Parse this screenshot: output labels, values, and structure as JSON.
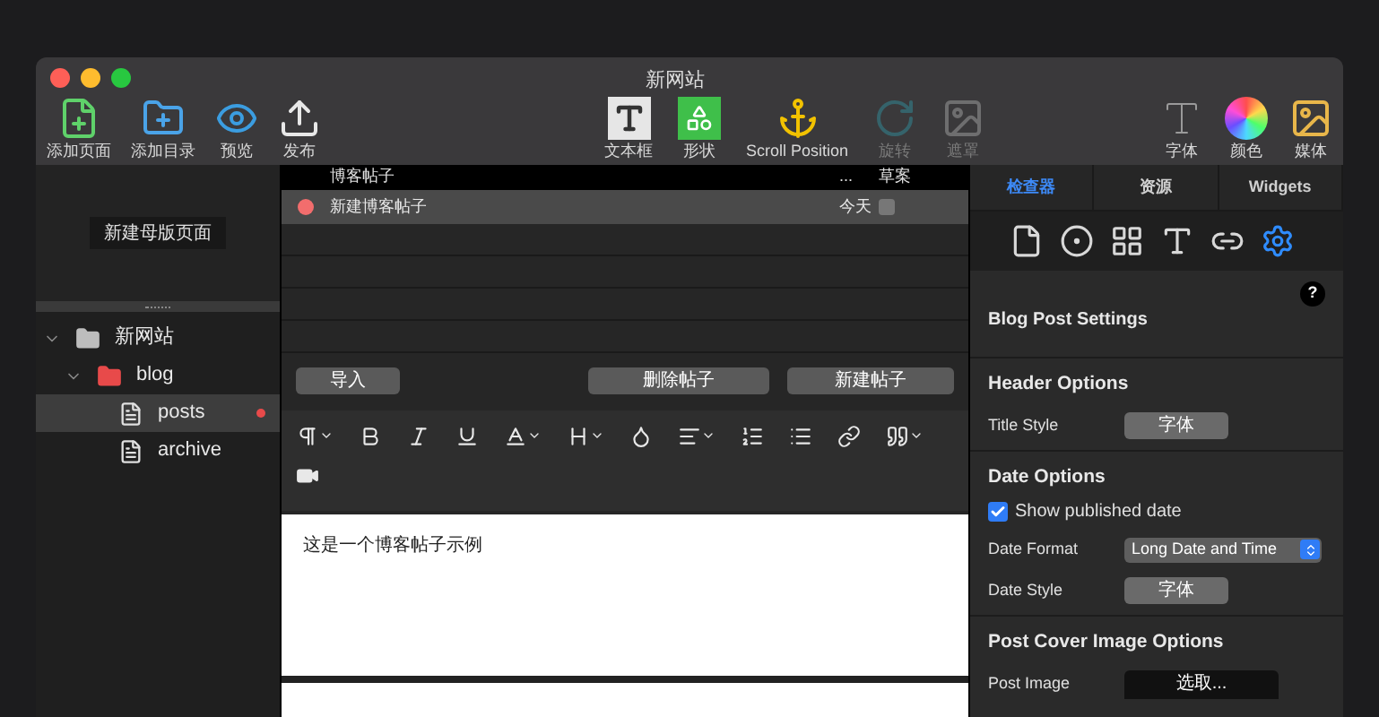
{
  "window": {
    "title": "新网站"
  },
  "toolbar": {
    "left": [
      {
        "label": "添加页面"
      },
      {
        "label": "添加目录"
      },
      {
        "label": "预览"
      },
      {
        "label": "发布"
      }
    ],
    "center": [
      {
        "label": "文本框",
        "disabled": false
      },
      {
        "label": "形状",
        "disabled": false
      },
      {
        "label": "Scroll Position",
        "disabled": false
      },
      {
        "label": "旋转",
        "disabled": true
      },
      {
        "label": "遮罩",
        "disabled": true
      }
    ],
    "right": [
      {
        "label": "字体"
      },
      {
        "label": "颜色"
      },
      {
        "label": "媒体"
      }
    ]
  },
  "sidebar": {
    "master_button": "新建母版页面",
    "tree": [
      {
        "label": "新网站",
        "kind": "site",
        "expanded": true,
        "selected": false,
        "children": [
          {
            "label": "blog",
            "kind": "folder",
            "expanded": true,
            "selected": false,
            "children": [
              {
                "label": "posts",
                "kind": "page",
                "selected": true,
                "unsaved": true
              },
              {
                "label": "archive",
                "kind": "page",
                "selected": false,
                "unsaved": false
              }
            ]
          }
        ]
      }
    ]
  },
  "table": {
    "columns": [
      "博客帖子",
      "...",
      "草案"
    ],
    "rows": [
      {
        "title": "新建博客帖子",
        "date": "今天",
        "draft": false,
        "selected": true,
        "color": "#f26d6d"
      }
    ]
  },
  "buttons": [
    "导入",
    "删除帖子",
    "新建帖子"
  ],
  "editor": {
    "body": "这是一个博客帖子示例"
  },
  "inspector": {
    "tabs": [
      {
        "label": "检查器",
        "selected": true
      },
      {
        "label": "资源",
        "selected": false
      },
      {
        "label": "Widgets",
        "selected": false
      }
    ],
    "icons": [
      {
        "selected": false
      },
      {
        "selected": false
      },
      {
        "selected": false
      },
      {
        "selected": false
      },
      {
        "selected": false
      },
      {
        "selected": true
      }
    ],
    "help": "?",
    "title": "Blog Post Settings",
    "sections": [
      {
        "title": "Header Options",
        "fields": [
          {
            "kind": "button",
            "label": "Title Style",
            "value": "字体"
          }
        ]
      },
      {
        "title": "Date Options",
        "fields": [
          {
            "kind": "checkbox",
            "label": "Show published date",
            "checked": true
          },
          {
            "kind": "select",
            "label": "Date Format",
            "value": "Long Date and Time"
          },
          {
            "kind": "button",
            "label": "Date Style",
            "value": "字体"
          }
        ]
      },
      {
        "title": "Post Cover Image Options",
        "fields": [
          {
            "kind": "picker",
            "label": "Post Image",
            "value": "选取..."
          }
        ]
      }
    ]
  }
}
